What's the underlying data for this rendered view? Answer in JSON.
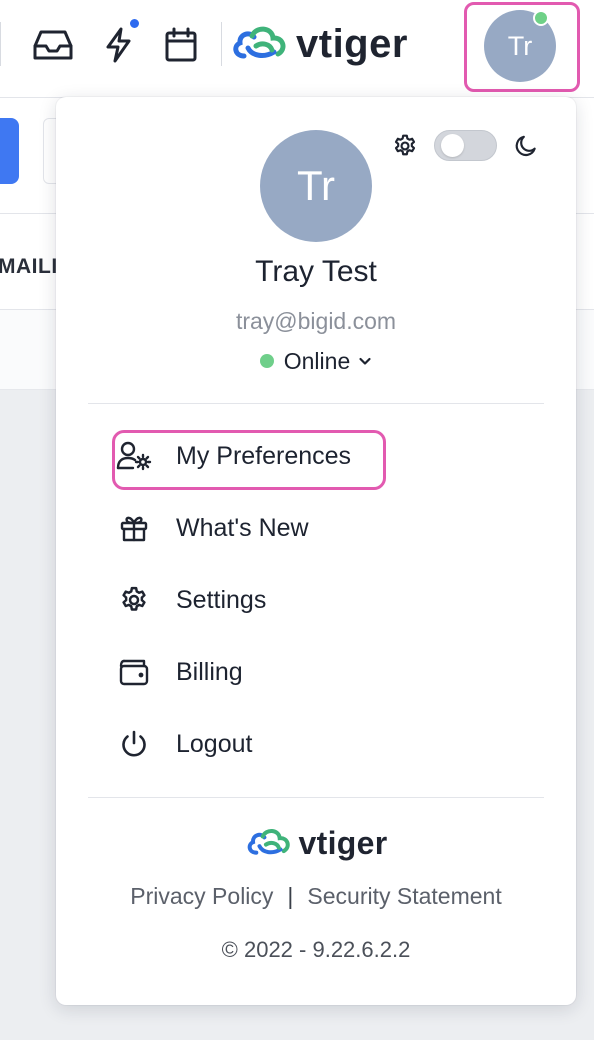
{
  "header": {
    "brand_name": "vtiger",
    "avatar_initials": "Tr",
    "icons": [
      "inbox-icon",
      "lightning-icon",
      "calendar-icon"
    ]
  },
  "background": {
    "tab_fragment": "MAILII"
  },
  "profile_menu": {
    "avatar_initials": "Tr",
    "name": "Tray Test",
    "email": "tray@bigid.com",
    "status": "Online",
    "theme_toggle_dark": false,
    "items": [
      {
        "label": "My Preferences",
        "icon": "user-gear-icon"
      },
      {
        "label": "What's New",
        "icon": "gift-icon"
      },
      {
        "label": "Settings",
        "icon": "gear-icon"
      },
      {
        "label": "Billing",
        "icon": "wallet-icon"
      },
      {
        "label": "Logout",
        "icon": "power-icon"
      }
    ],
    "footer": {
      "brand_name": "vtiger",
      "privacy": "Privacy Policy",
      "separator": "|",
      "security": "Security Statement",
      "copyright": "© 2022 - 9.22.6.2.2"
    }
  },
  "colors": {
    "highlight": "#e25ab0",
    "avatar_bg": "#97a9c4",
    "online": "#6fcf8a",
    "notify": "#2e6bf0",
    "logo_blue": "#2d6fe0",
    "logo_green": "#3fb37a"
  }
}
